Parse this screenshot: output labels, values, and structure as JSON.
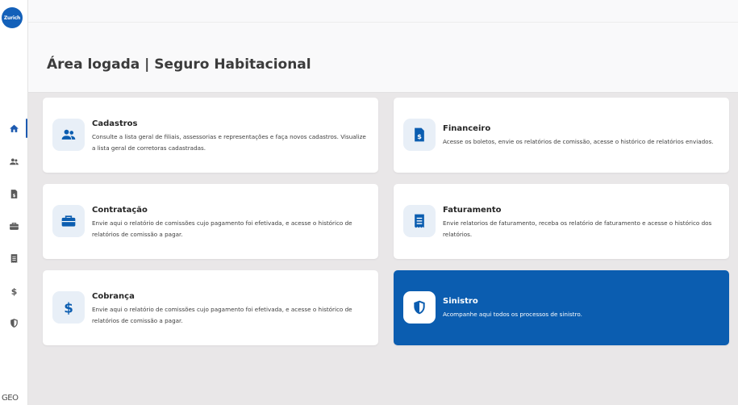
{
  "brand": {
    "logo_text": "Zurich",
    "footer_logo": "GEO"
  },
  "sidebar": {
    "items": [
      {
        "name": "home",
        "icon": "home-icon"
      },
      {
        "name": "users",
        "icon": "users-icon"
      },
      {
        "name": "financeiro",
        "icon": "document-dollar-icon"
      },
      {
        "name": "contratacao",
        "icon": "briefcase-icon"
      },
      {
        "name": "faturamento",
        "icon": "receipt-icon"
      },
      {
        "name": "cobranca",
        "icon": "dollar-icon"
      },
      {
        "name": "sinistro",
        "icon": "shield-icon"
      }
    ],
    "active_index": 0
  },
  "page": {
    "title": "Área logada | Seguro Habitacional"
  },
  "cards": [
    {
      "title": "Cadastros",
      "description": "Consulte a lista geral de filiais, assessorias e representações e faça novos cadastros. Visualize a lista geral de corretoras cadastradas.",
      "icon": "users-icon"
    },
    {
      "title": "Financeiro",
      "description": "Acesse os boletos, envie os relatórios de comissão, acesse o histórico de relatórios enviados.",
      "icon": "document-dollar-icon"
    },
    {
      "title": "Contratação",
      "description": "Envie aqui o relatório de comissões cujo pagamento foi efetivada, e acesse o histórico de relatórios de comissão a pagar.",
      "icon": "briefcase-icon"
    },
    {
      "title": "Faturamento",
      "description": "Envie relatorios de faturamento, receba os relatório de faturamento e acesse o histórico dos relatórios.",
      "icon": "receipt-icon"
    },
    {
      "title": "Cobrança",
      "description": "Envie aqui o relatório de comissões cujo pagamento foi efetivada, e acesse o histórico de relatórios de comissão a pagar.",
      "icon": "dollar-icon"
    },
    {
      "title": "Sinistro",
      "description": "Acompanhe aqui todos os processos de sinistro.",
      "icon": "shield-icon"
    }
  ],
  "colors": {
    "primary": "#0b5db0",
    "icon_bg": "#e8eff7",
    "sidebar_icon": "#5a5a5a",
    "background": "#e9e7e8"
  }
}
